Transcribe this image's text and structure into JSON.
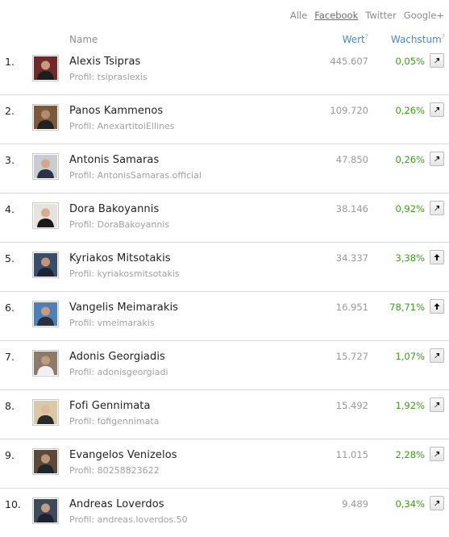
{
  "filters": [
    {
      "label": "Alle",
      "active": false
    },
    {
      "label": "Facebook",
      "active": true
    },
    {
      "label": "Twitter",
      "active": false
    },
    {
      "label": "Google+",
      "active": false
    }
  ],
  "header": {
    "name": "Name",
    "wert": "Wert",
    "wachstum": "Wachstum",
    "help_mark": "?"
  },
  "colors": {
    "link_blue": "#4a86c5",
    "growth_green": "#3b9a1a",
    "muted_gray": "#a0a0a0"
  },
  "rows": [
    {
      "rank": "1.",
      "name": "Alexis Tsipras",
      "profile": "Profil: tsipraslexis",
      "value": "445.607",
      "growth": "0,05%",
      "trend_icon": "arrow-up-right-icon"
    },
    {
      "rank": "2.",
      "name": "Panos Kammenos",
      "profile": "Profil: AnexartitoiEllines",
      "value": "109.720",
      "growth": "0,26%",
      "trend_icon": "arrow-up-right-icon"
    },
    {
      "rank": "3.",
      "name": "Antonis Samaras",
      "profile": "Profil: AntonisSamaras.official",
      "value": "47.850",
      "growth": "0,26%",
      "trend_icon": "arrow-up-right-icon"
    },
    {
      "rank": "4.",
      "name": "Dora Bakoyannis",
      "profile": "Profil: DoraBakoyannis",
      "value": "38.146",
      "growth": "0,92%",
      "trend_icon": "arrow-up-right-icon"
    },
    {
      "rank": "5.",
      "name": "Kyriakos Mitsotakis",
      "profile": "Profil: kyriakosmitsotakis",
      "value": "34.337",
      "growth": "3,38%",
      "trend_icon": "arrow-up-icon"
    },
    {
      "rank": "6.",
      "name": "Vangelis Meimarakis",
      "profile": "Profil: vmeimarakis",
      "value": "16.951",
      "growth": "78,71%",
      "trend_icon": "arrow-up-icon"
    },
    {
      "rank": "7.",
      "name": "Adonis Georgiadis",
      "profile": "Profil: adonisgeorgiadi",
      "value": "15.727",
      "growth": "1,07%",
      "trend_icon": "arrow-up-right-icon"
    },
    {
      "rank": "8.",
      "name": "Fofi Gennimata",
      "profile": "Profil: fofigennimata",
      "value": "15.492",
      "growth": "1,92%",
      "trend_icon": "arrow-up-right-icon"
    },
    {
      "rank": "9.",
      "name": "Evangelos Venizelos",
      "profile": "Profil: 80258823622",
      "value": "11.015",
      "growth": "2,28%",
      "trend_icon": "arrow-up-right-icon"
    },
    {
      "rank": "10.",
      "name": "Andreas Loverdos",
      "profile": "Profil: andreas.loverdos.50",
      "value": "9.489",
      "growth": "0,34%",
      "trend_icon": "arrow-up-right-icon"
    }
  ]
}
